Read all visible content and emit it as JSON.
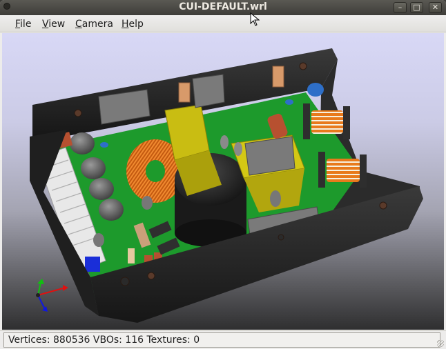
{
  "window": {
    "title": "CUI-DEFAULT.wrl",
    "controls": {
      "minimize": "–",
      "maximize": "□",
      "close": "✕"
    }
  },
  "menu": {
    "file": {
      "accel": "F",
      "rest": "ile"
    },
    "view": {
      "accel": "V",
      "rest": "iew"
    },
    "camera": {
      "accel": "C",
      "rest": "amera"
    },
    "help": {
      "accel": "H",
      "rest": "elp"
    }
  },
  "status": {
    "text": "Vertices: 880536 VBOs: 116 Textures: 0"
  },
  "colors": {
    "pcb": "#1a9a2a",
    "chassis": "#2a2a2a",
    "toroid": "#d96a1a",
    "transformer": "#c8bd10",
    "background_top": "#d8d8f6",
    "background_bottom": "#2f2f30"
  },
  "icons": {
    "axis": "xyz-axis-icon",
    "cursor": "mouse-pointer-icon"
  }
}
